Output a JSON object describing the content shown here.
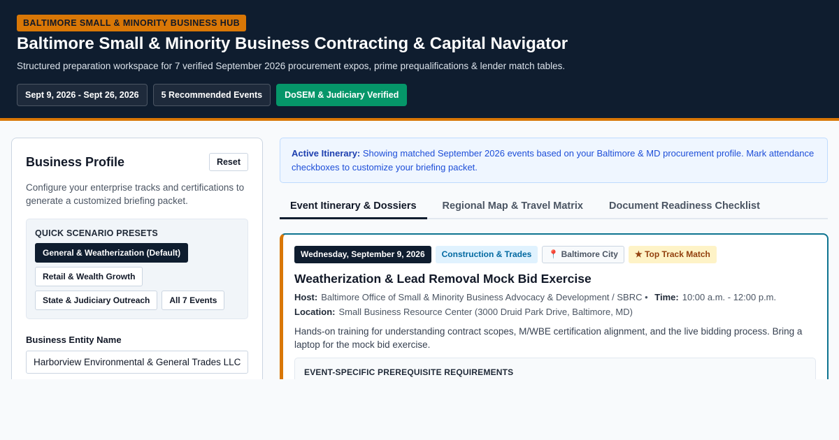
{
  "header": {
    "badge": "BALTIMORE SMALL & MINORITY BUSINESS HUB",
    "title": "Baltimore Small & Minority Business Contracting & Capital Navigator",
    "subtitle": "Structured preparation workspace for 7 verified September 2026 procurement expos, prime prequalifications & lender match tables.",
    "pills": [
      {
        "label": "Sept 9, 2026 - Sept 26, 2026"
      },
      {
        "label": "5 Recommended Events"
      },
      {
        "label": "DoSEM & Judiciary Verified"
      }
    ],
    "accent_color": "#d97706",
    "bg_color": "#0f1d2f",
    "verified_color": "#059669"
  },
  "profile": {
    "title": "Business Profile",
    "reset_label": "Reset",
    "description": "Configure your enterprise tracks and certifications to generate a customized briefing packet.",
    "presets_title": "QUICK SCENARIO PRESETS",
    "presets": [
      {
        "label": "General & Weatherization (Default)",
        "active": true
      },
      {
        "label": "Retail & Wealth Growth",
        "active": false
      },
      {
        "label": "State & Judiciary Outreach",
        "active": false
      },
      {
        "label": "All 7 Events",
        "active": false
      }
    ],
    "entity_label": "Business Entity Name",
    "entity_value": "Harborview Environmental & General Trades LLC"
  },
  "notice": {
    "bold": "Active Itinerary:",
    "text": "Showing matched September 2026 events based on your Baltimore & MD procurement profile. Mark attendance checkboxes to customize your briefing packet."
  },
  "tabs": [
    {
      "label": "Event Itinerary & Dossiers",
      "active": true
    },
    {
      "label": "Regional Map & Travel Matrix",
      "active": false
    },
    {
      "label": "Document Readiness Checklist",
      "active": false
    }
  ],
  "event": {
    "date": "Wednesday, September 9, 2026",
    "track": "Construction & Trades",
    "location_tag": "Baltimore City",
    "location_icon": "pin-icon",
    "match": "Top Track Match",
    "match_icon": "star-icon",
    "title": "Weatherization & Lead Removal Mock Bid Exercise",
    "host_label": "Host:",
    "host": "Baltimore Office of Small & Minority Business Advocacy & Development / SBRC •",
    "time_label": "Time:",
    "time": "10:00 a.m. - 12:00 p.m.",
    "location_label": "Location:",
    "location": "Small Business Resource Center (3000 Druid Park Drive, Baltimore, MD)",
    "description": "Hands-on training for understanding contract scopes, M/WBE certification alignment, and the live bidding process. Bring a laptop for the mock bid exercise.",
    "prereq_title": "EVENT-SPECIFIC PREREQUISITE REQUIREMENTS"
  }
}
